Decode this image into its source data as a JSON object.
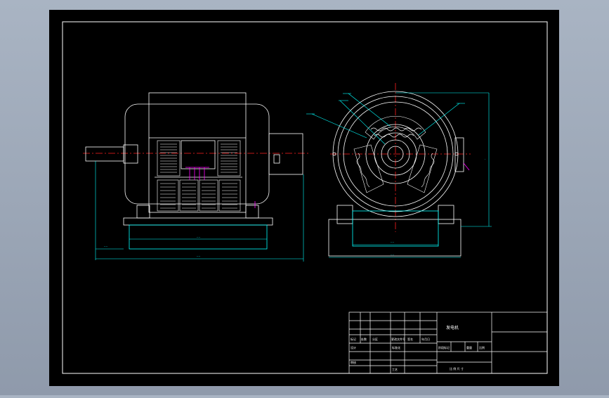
{
  "drawing": {
    "colors": {
      "background": "#000000",
      "frame": "#ffffff",
      "centerline": "#ff2020",
      "dimension": "#00ffff",
      "leader": "#00ffff",
      "part": "#ffffff",
      "terminal": "#ff00ff",
      "hatch": "#ffffff"
    },
    "title_block": {
      "name_cell": "发电机",
      "footer_cell": "比 例 尺 寸",
      "row_labels": [
        "标记",
        "处数",
        "分区",
        "更改文件号",
        "签名",
        "年月日"
      ],
      "row2_labels": [
        "设计",
        "",
        "标准化",
        "",
        ""
      ],
      "row3_labels": [
        "审核",
        "",
        "工艺",
        "",
        ""
      ],
      "stage_labels": [
        "阶段标记",
        "重量",
        "比例"
      ]
    }
  }
}
